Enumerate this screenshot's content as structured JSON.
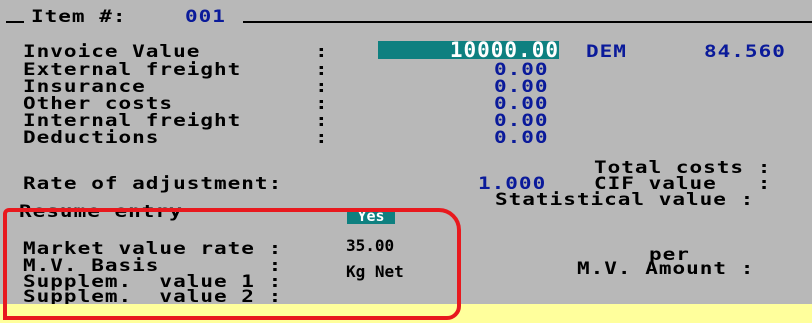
{
  "header": {
    "prefix": "Item #:",
    "number": "001"
  },
  "costs": {
    "rows": [
      {
        "label": "Invoice Value",
        "colon": ":",
        "value": "10000.00"
      },
      {
        "label": "External freight",
        "colon": ":",
        "value": "0.00"
      },
      {
        "label": "Insurance",
        "colon": ":",
        "value": "0.00"
      },
      {
        "label": "Other costs",
        "colon": ":",
        "value": "0.00"
      },
      {
        "label": "Internal freight",
        "colon": ":",
        "value": "0.00"
      },
      {
        "label": "Deductions",
        "colon": ":",
        "value": "0.00"
      }
    ],
    "currency": "DEM",
    "exchange_rate": "84.560"
  },
  "totals": {
    "total_costs": "Total costs :",
    "cif_value": "CIF value   :",
    "statistical_value": "Statistical value :"
  },
  "adjustment": {
    "label": "Rate of adjustment:",
    "value": "1.000"
  },
  "resume": {
    "label": "Resume entry",
    "value": "Yes"
  },
  "market": {
    "rate_label": "Market value rate :",
    "rate_value": "35.00",
    "basis_label": "M.V. Basis        :",
    "basis_value": "Kg Net",
    "supp1_label": "Supplem.  value 1 :",
    "supp2_label": "Supplem.  value 2 :",
    "per_label": "per",
    "amount_label": "M.V. Amount :"
  },
  "colors": {
    "background": "#b8b8b8",
    "field": "#0e8080",
    "value_text": "#0a1a9a",
    "annotation": "#e8191e",
    "status_strip": "#ffff9c"
  }
}
